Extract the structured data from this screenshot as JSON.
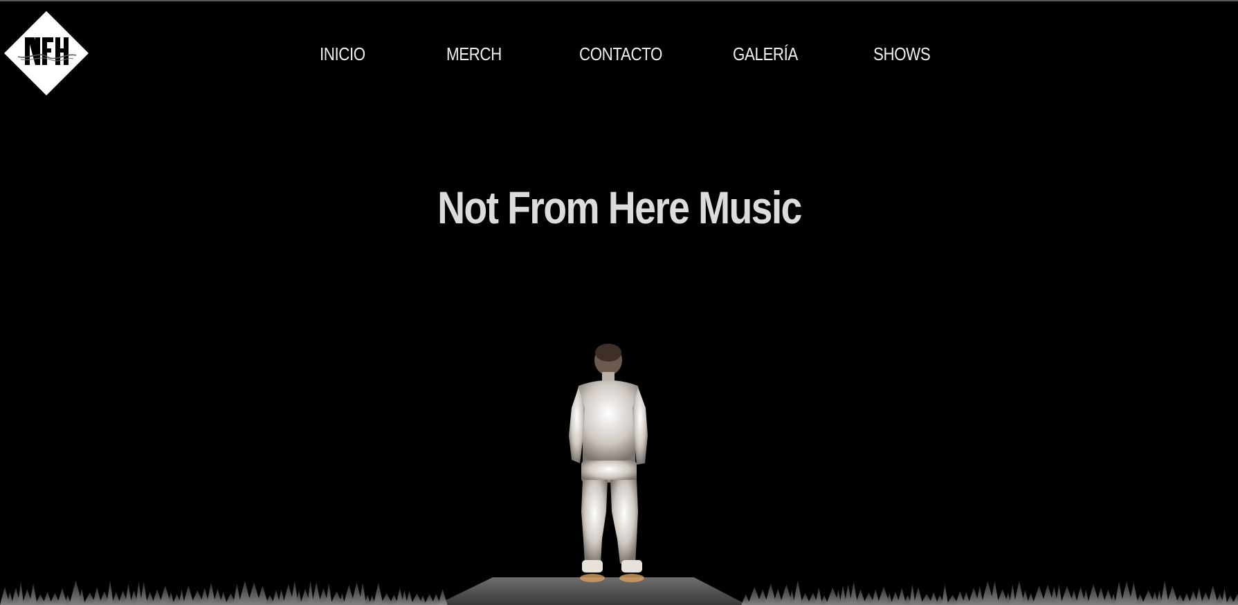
{
  "brand": {
    "logo_text": "NFH",
    "logo_script": "music"
  },
  "nav": {
    "items": [
      {
        "label": "INICIO"
      },
      {
        "label": "MERCH"
      },
      {
        "label": "CONTACTO"
      },
      {
        "label": "GALERÍA"
      },
      {
        "label": "SHOWS"
      }
    ]
  },
  "hero": {
    "title": "Not From Here Music",
    "image": "figure-on-stage-illustration"
  },
  "colors": {
    "background": "#000000",
    "text": "#dcdcdc",
    "logo_fill": "#ffffff"
  }
}
